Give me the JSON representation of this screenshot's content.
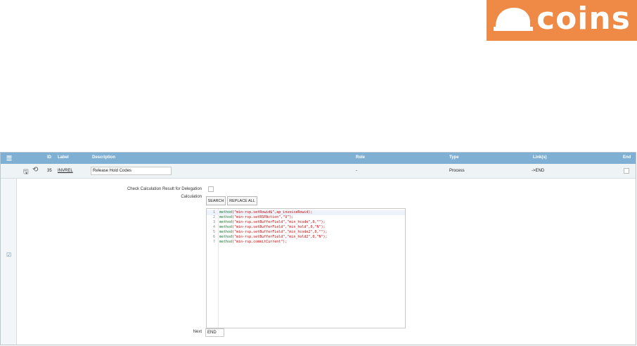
{
  "logo": {
    "text": "coins",
    "color": "#ee8a45"
  },
  "grid": {
    "headers": {
      "id": "ID",
      "label": "Label",
      "description": "Description",
      "role": "Role",
      "type": "Type",
      "links": "Link(s)",
      "end": "End"
    },
    "row": {
      "id": "35",
      "label": "INVREL",
      "description": "Release Hold Codes",
      "role": "-",
      "type": "Process",
      "links": "->END",
      "end_checked": false
    }
  },
  "detail": {
    "check_calc_label": "Check Calculation Result for Delegation",
    "check_calc_checked": false,
    "calculation_label": "Calculation",
    "search_button": "SEARCH",
    "replace_all_button": "REPLACE ALL",
    "code_lines": [
      {
        "n": "1",
        "fn": "method",
        "args": "(\"min-rsp.setRowid$\",ap_invoiceRowid);"
      },
      {
        "n": "2",
        "fn": "method",
        "args": "(\"min-rsp.setRSPAction\",\"U\");"
      },
      {
        "n": "3",
        "fn": "method",
        "args": "(\"min-rsp.setBufferField\",\"min_hcode\",0,\"\");"
      },
      {
        "n": "4",
        "fn": "method",
        "args": "(\"min-rsp.setBufferField\",\"min_hold\",0,\"N\");"
      },
      {
        "n": "5",
        "fn": "method",
        "args": "(\"min-rsp.setBufferField\",\"min_hcode2\",0,\"\");"
      },
      {
        "n": "6",
        "fn": "method",
        "args": "(\"min-rsp.setBufferField\",\"min_hold2\",0,\"N\");"
      },
      {
        "n": "7",
        "fn": "method",
        "args": "(\"min-rsp.commitCurrent\");"
      }
    ],
    "next_label": "Next",
    "next_value": "END"
  }
}
